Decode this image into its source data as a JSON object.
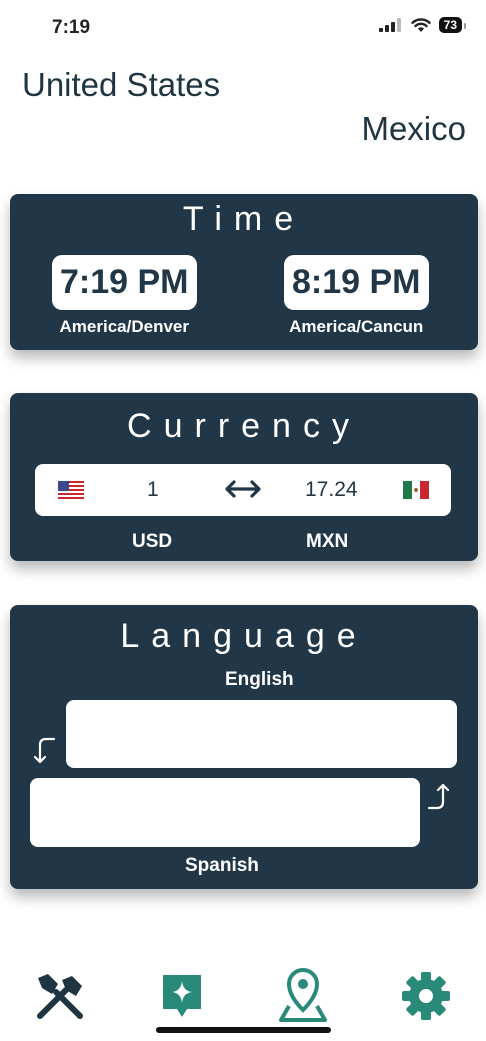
{
  "status_bar": {
    "time": "7:19",
    "battery": "73"
  },
  "header": {
    "from_country": "United States",
    "to_country": "Mexico"
  },
  "time_card": {
    "title": "Time",
    "from_time": "7:19 PM",
    "from_zone": "America/Denver",
    "to_time": "8:19 PM",
    "to_zone": "America/Cancun"
  },
  "currency_card": {
    "title": "Currency",
    "from_amount": "1",
    "to_amount": "17.24",
    "from_code": "USD",
    "to_code": "MXN"
  },
  "language_card": {
    "title": "Language",
    "from_language": "English",
    "to_language": "Spanish",
    "from_text": "",
    "to_text": ""
  },
  "tab_bar": {
    "items": [
      {
        "icon": "tools-icon",
        "color": "#1f3542"
      },
      {
        "icon": "sparkle-chat-icon",
        "color": "#2a8a7a"
      },
      {
        "icon": "map-pin-icon",
        "color": "#2a8a7a"
      },
      {
        "icon": "gear-icon",
        "color": "#2a8a7a"
      }
    ]
  },
  "colors": {
    "card_bg": "#213646",
    "accent": "#2a8a7a",
    "text": "#1f3542"
  }
}
